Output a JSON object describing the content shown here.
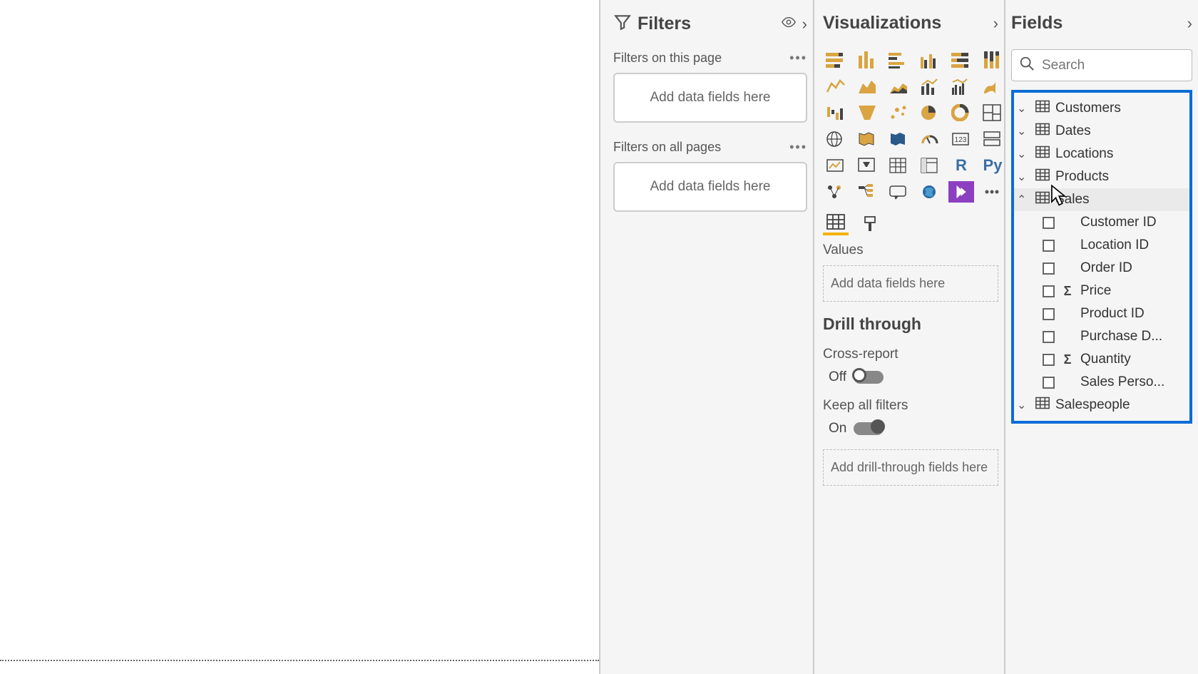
{
  "filters": {
    "title": "Filters",
    "this_page_label": "Filters on this page",
    "all_pages_label": "Filters on all pages",
    "drop_text": "Add data fields here"
  },
  "viz": {
    "title": "Visualizations",
    "values_label": "Values",
    "values_drop": "Add data fields here",
    "drill_title": "Drill through",
    "cross_report": "Cross-report",
    "off": "Off",
    "keep_filters": "Keep all filters",
    "on": "On",
    "drill_drop": "Add drill-through fields here"
  },
  "fields": {
    "title": "Fields",
    "search_placeholder": "Search",
    "tables": [
      {
        "name": "Customers",
        "expanded": false
      },
      {
        "name": "Dates",
        "expanded": false
      },
      {
        "name": "Locations",
        "expanded": false
      },
      {
        "name": "Products",
        "expanded": false
      },
      {
        "name": "Sales",
        "expanded": true,
        "fields": [
          {
            "name": "Customer ID",
            "agg": false
          },
          {
            "name": "Location ID",
            "agg": false
          },
          {
            "name": "Order ID",
            "agg": false
          },
          {
            "name": "Price",
            "agg": true
          },
          {
            "name": "Product ID",
            "agg": false
          },
          {
            "name": "Purchase D...",
            "agg": false
          },
          {
            "name": "Quantity",
            "agg": true
          },
          {
            "name": "Sales Perso...",
            "agg": false
          }
        ]
      },
      {
        "name": "Salespeople",
        "expanded": false
      }
    ]
  }
}
